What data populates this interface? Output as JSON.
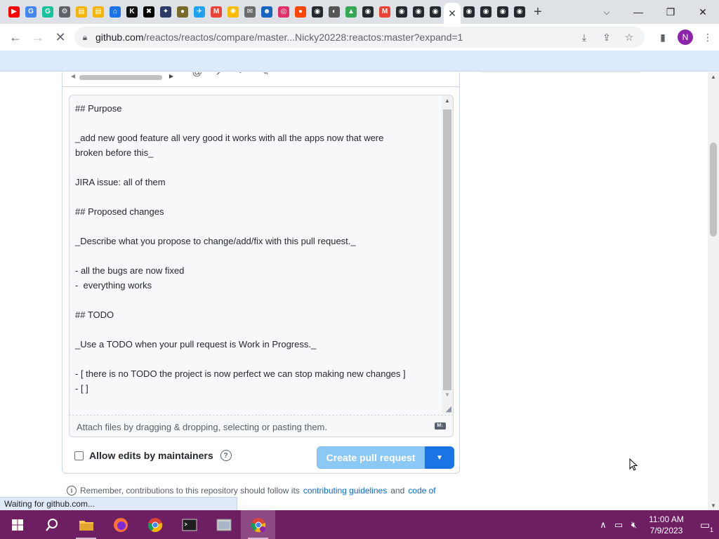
{
  "browser": {
    "tabs": [
      {
        "icon": "youtube-icon",
        "color": "#ff0000",
        "glyph": "▶"
      },
      {
        "icon": "google-icon",
        "color": "#4285f4",
        "glyph": "G"
      },
      {
        "icon": "grammarly-icon",
        "color": "#15c39a",
        "glyph": "G"
      },
      {
        "icon": "settings-icon",
        "color": "#5f6368",
        "glyph": "⚙"
      },
      {
        "icon": "folder-icon",
        "color": "#f4b400",
        "glyph": "▤"
      },
      {
        "icon": "folder-icon",
        "color": "#f4b400",
        "glyph": "▤"
      },
      {
        "icon": "launch-icon",
        "color": "#1a73e8",
        "glyph": "⌂"
      },
      {
        "icon": "kim-icon",
        "color": "#111111",
        "glyph": "K"
      },
      {
        "icon": "cross-icon",
        "color": "#000000",
        "glyph": "✖"
      },
      {
        "icon": "game-icon",
        "color": "#2b3a67",
        "glyph": "✦"
      },
      {
        "icon": "badge-icon",
        "color": "#7a6a2a",
        "glyph": "●"
      },
      {
        "icon": "twitter-icon",
        "color": "#1da1f2",
        "glyph": "✈"
      },
      {
        "icon": "gmail-icon",
        "color": "#ea4335",
        "glyph": "M"
      },
      {
        "icon": "lightbulb-icon",
        "color": "#fbbc04",
        "glyph": "✺"
      },
      {
        "icon": "page-icon",
        "color": "#6b6b6b",
        "glyph": "✉"
      },
      {
        "icon": "sonic-icon",
        "color": "#1565c0",
        "glyph": "☻"
      },
      {
        "icon": "instagram-icon",
        "color": "#e1306c",
        "glyph": "◎"
      },
      {
        "icon": "reddit-icon",
        "color": "#ff4500",
        "glyph": "●"
      },
      {
        "icon": "github-icon",
        "color": "#24292f",
        "glyph": "◉"
      },
      {
        "icon": "steam-icon",
        "color": "#555555",
        "glyph": "◐"
      },
      {
        "icon": "drive-icon",
        "color": "#34a853",
        "glyph": "▲"
      },
      {
        "icon": "github-icon",
        "color": "#24292f",
        "glyph": "◉"
      },
      {
        "icon": "gmail-icon",
        "color": "#ea4335",
        "glyph": "M"
      },
      {
        "icon": "github-icon",
        "color": "#24292f",
        "glyph": "◉"
      },
      {
        "icon": "github-icon",
        "color": "#24292f",
        "glyph": "◉"
      },
      {
        "icon": "github-icon",
        "color": "#24292f",
        "glyph": "◉"
      }
    ],
    "tabs_after": [
      {
        "icon": "github-icon",
        "color": "#24292f",
        "glyph": "◉"
      },
      {
        "icon": "github-icon",
        "color": "#24292f",
        "glyph": "◉"
      },
      {
        "icon": "github-icon",
        "color": "#24292f",
        "glyph": "◉"
      },
      {
        "icon": "github-icon",
        "color": "#24292f",
        "glyph": "◉"
      }
    ],
    "url_host": "github.com",
    "url_path": "/reactos/reactos/compare/master...Nicky20228:reactos:master?expand=1",
    "profile_initial": "N"
  },
  "editor": {
    "lines": [
      "## Purpose",
      "",
      "_add new good feature all very good it works with all the apps now that were",
      "broken before this_",
      "",
      "JIRA issue: all of them",
      "",
      "## Proposed changes",
      "",
      "_Describe what you propose to change/add/fix with this pull request._",
      "",
      "- all the bugs are now fixed",
      "-  everything works",
      "",
      "## TODO",
      "",
      "_Use a TODO when your pull request is Work in Progress._",
      "",
      "- [ there is no TODO the project is now perfect we can stop making new changes ]",
      "- [ ]"
    ],
    "attach_hint": "Attach files by dragging & dropping, selecting or pasting them.",
    "markdown_icon": "markdown-icon"
  },
  "form": {
    "allow_edits_label": "Allow edits by maintainers",
    "allow_edits_checked": false,
    "create_button": "Create pull request"
  },
  "footer": {
    "remember_prefix": "Remember, contributions to this repository should follow its",
    "contributing_link": "contributing guidelines",
    "and": "and",
    "coc_link": "code of"
  },
  "status": "Waiting for github.com...",
  "taskbar": {
    "time": "11:00 AM",
    "date": "7/9/2023",
    "notifications": "1"
  }
}
